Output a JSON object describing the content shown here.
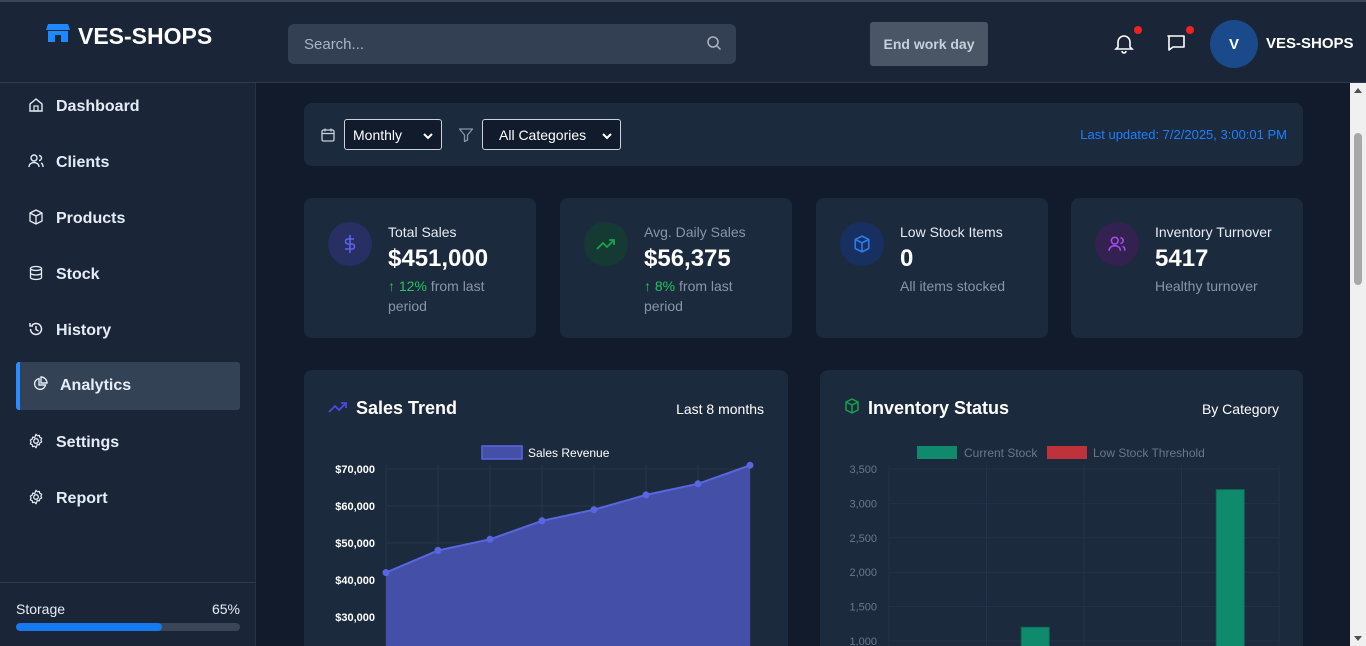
{
  "header": {
    "brand": "VES-SHOPS",
    "search_placeholder": "Search...",
    "end_work_day": "End work day",
    "avatar_initial": "V",
    "username": "VES-SHOPS"
  },
  "sidebar": {
    "items": [
      {
        "label": "Dashboard",
        "icon": "home-icon"
      },
      {
        "label": "Clients",
        "icon": "users-icon"
      },
      {
        "label": "Products",
        "icon": "box-icon"
      },
      {
        "label": "Stock",
        "icon": "database-icon"
      },
      {
        "label": "History",
        "icon": "history-icon"
      },
      {
        "label": "Analytics",
        "icon": "pie-chart-icon",
        "active": true
      },
      {
        "label": "Settings",
        "icon": "gear-icon"
      },
      {
        "label": "Report",
        "icon": "gear-icon"
      }
    ],
    "storage": {
      "label": "Storage",
      "percent_text": "65%",
      "fraction": 0.65
    }
  },
  "filters": {
    "period": "Monthly",
    "category": "All Categories",
    "last_updated": "Last updated: 7/2/2025, 3:00:01 PM"
  },
  "cards": [
    {
      "label": "Total Sales",
      "value": "$451,000",
      "change": "↑ 12%",
      "sub": " from last period",
      "icon": "dollar-icon",
      "color": "#4f46e5"
    },
    {
      "label": "Avg. Daily Sales",
      "value": "$56,375",
      "change": "↑ 8%",
      "sub": " from last period",
      "icon": "trending-up-icon",
      "color": "#16a34a"
    },
    {
      "label": "Low Stock Items",
      "value": "0",
      "change": "",
      "sub": "All items stocked",
      "icon": "box-icon",
      "color": "#2563eb"
    },
    {
      "label": "Inventory Turnover",
      "value": "5417",
      "change": "",
      "sub": "Healthy turnover",
      "icon": "users-icon",
      "color": "#9333ea"
    }
  ],
  "sales_panel": {
    "title": "Sales Trend",
    "right": "Last 8 months"
  },
  "inventory_panel": {
    "title": "Inventory Status",
    "right": "By Category"
  },
  "chart_data": [
    {
      "type": "area",
      "series": [
        {
          "name": "Sales Revenue",
          "values": [
            42000,
            48000,
            51000,
            56000,
            59000,
            63000,
            66000,
            71000
          ]
        }
      ],
      "yticks": [
        "$70,000",
        "$60,000",
        "$50,000",
        "$40,000",
        "$30,000"
      ],
      "colors": {
        "fill": "#4450a8",
        "line": "#5a66e0"
      }
    },
    {
      "type": "bar",
      "series": [
        {
          "name": "Current Stock",
          "values": [
            0,
            1200,
            0,
            3200
          ]
        },
        {
          "name": "Low Stock Threshold",
          "values": [
            0,
            0,
            0,
            0
          ]
        }
      ],
      "ylim": [
        0,
        3500
      ],
      "yticks": [
        "3,500",
        "3,000",
        "2,500",
        "2,000",
        "1,500",
        "1,000"
      ],
      "colors": {
        "current": "#0f8a6c",
        "threshold": "#c0323a"
      }
    }
  ]
}
